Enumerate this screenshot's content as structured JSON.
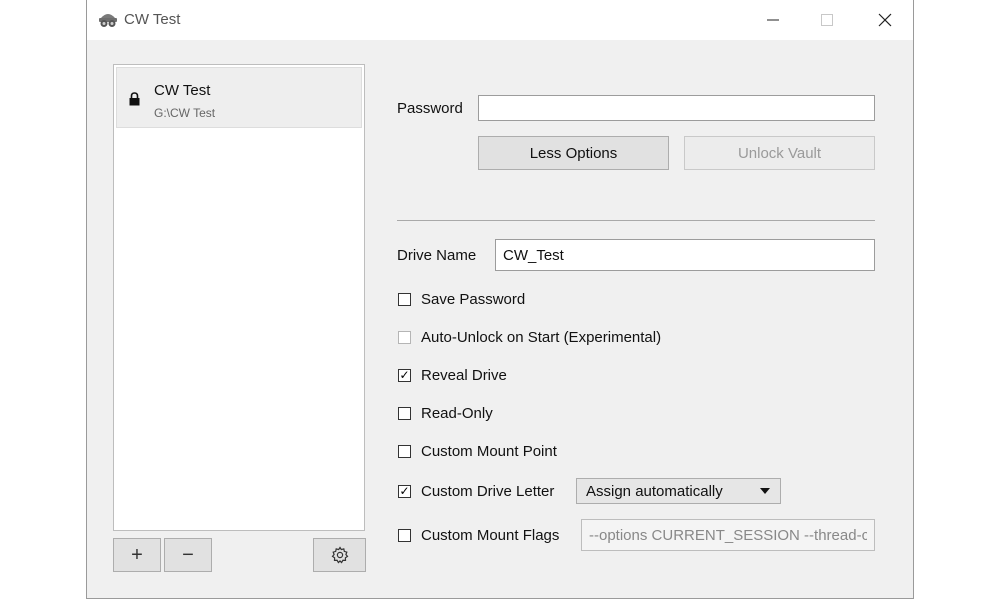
{
  "window": {
    "title": "CW Test"
  },
  "vault_list": {
    "items": [
      {
        "name": "CW Test",
        "path": "G:\\CW Test",
        "icon": "lock-icon"
      }
    ],
    "add_label": "+",
    "remove_label": "−"
  },
  "unlock": {
    "password_label": "Password",
    "password_value": "",
    "less_options_label": "Less Options",
    "unlock_vault_label": "Unlock Vault"
  },
  "options": {
    "drive_name_label": "Drive Name",
    "drive_name_value": "CW_Test",
    "save_password": {
      "label": "Save Password",
      "checked": false
    },
    "auto_unlock": {
      "label": "Auto-Unlock on Start (Experimental)",
      "checked": false
    },
    "reveal_drive": {
      "label": "Reveal Drive",
      "checked": true
    },
    "read_only": {
      "label": "Read-Only",
      "checked": false
    },
    "custom_mount_point": {
      "label": "Custom Mount Point",
      "checked": false
    },
    "custom_drive_letter": {
      "label": "Custom Drive Letter",
      "checked": true,
      "selected": "Assign automatically"
    },
    "custom_mount_flags": {
      "label": "Custom Mount Flags",
      "checked": false,
      "value": "--options CURRENT_SESSION --thread-c"
    }
  }
}
